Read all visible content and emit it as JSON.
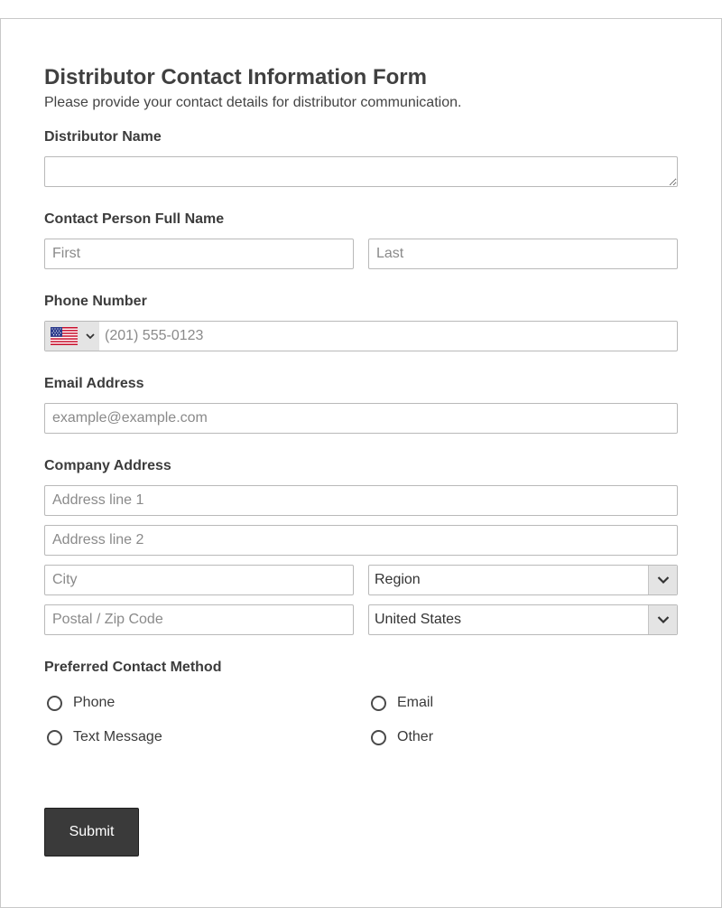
{
  "form": {
    "title": "Distributor Contact Information Form",
    "subtitle": "Please provide your contact details for distributor communication."
  },
  "distributor_name": {
    "label": "Distributor Name",
    "value": ""
  },
  "contact_person": {
    "label": "Contact Person Full Name",
    "first_placeholder": "First",
    "last_placeholder": "Last"
  },
  "phone": {
    "label": "Phone Number",
    "country_flag": "us-flag-icon",
    "placeholder": "(201) 555-0123"
  },
  "email": {
    "label": "Email Address",
    "placeholder": "example@example.com"
  },
  "address": {
    "label": "Company Address",
    "line1_placeholder": "Address line 1",
    "line2_placeholder": "Address line 2",
    "city_placeholder": "City",
    "region_value": "Region",
    "postal_placeholder": "Postal / Zip Code",
    "country_value": "United States"
  },
  "contact_method": {
    "label": "Preferred Contact Method",
    "options": [
      "Phone",
      "Email",
      "Text Message",
      "Other"
    ]
  },
  "submit": {
    "label": "Submit"
  },
  "colors": {
    "button_bg": "#3a3a3a",
    "border": "#b9b9b9",
    "select_arrow_bg": "#e4e4e4"
  }
}
